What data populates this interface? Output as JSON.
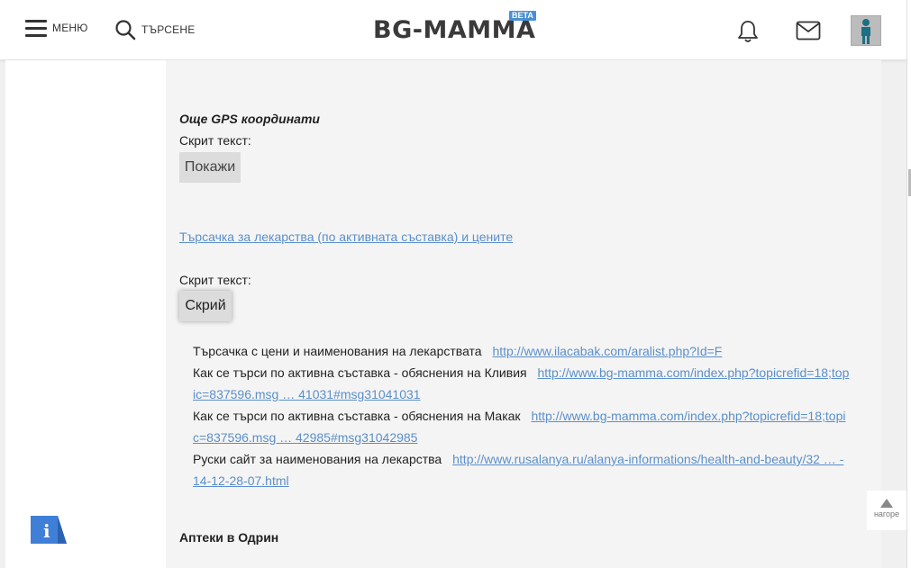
{
  "header": {
    "menu_label": "МЕНЮ",
    "search_label": "ТЪРСЕНЕ",
    "logo_text": "BG-MAMMA",
    "beta_badge": "BETA",
    "icons": [
      "menu-icon",
      "search-icon",
      "bell-icon",
      "mail-icon",
      "user-avatar"
    ]
  },
  "post": {
    "heading_gps": "Още GPS координати",
    "hidden_text_label_1": "Скрит текст:",
    "show_button": "Покажи",
    "drug_search_link": "Търсачка за лекарства (по активната съставка) и цените",
    "hidden_text_label_2": "Скрит текст:",
    "hide_button": "Скрий",
    "rows": [
      {
        "label": "Търсачка с цени и наименования на лекарствата",
        "link": "http://www.ilacabak.com/aralist.php?Id=F"
      },
      {
        "label": "Как се търси по активна съставка - обяснения на Кливия",
        "link": "http://www.bg-mamma.com/index.php?topicrefid=18;topic=837596.msg … 41031#msg31041031"
      },
      {
        "label": "Как се търси по активна съставка - обяснения на Макак",
        "link": "http://www.bg-mamma.com/index.php?topicrefid=18;topic=837596.msg … 42985#msg31042985"
      },
      {
        "label": "Руски сайт за наименования на лекарства",
        "link": "http://www.rusalanya.ru/alanya-informations/health-and-beauty/32 … -14-12-28-07.html"
      }
    ],
    "heading_pharmacies": "Аптеки в Одрин"
  },
  "widgets": {
    "to_top_label": "нагоре",
    "info_icon": "i"
  },
  "colors": {
    "link": "#5b8fc9",
    "beta_bg": "#4a8fd6",
    "post_bg": "#f4f4f4",
    "info_blue": "#3f7fd8"
  }
}
